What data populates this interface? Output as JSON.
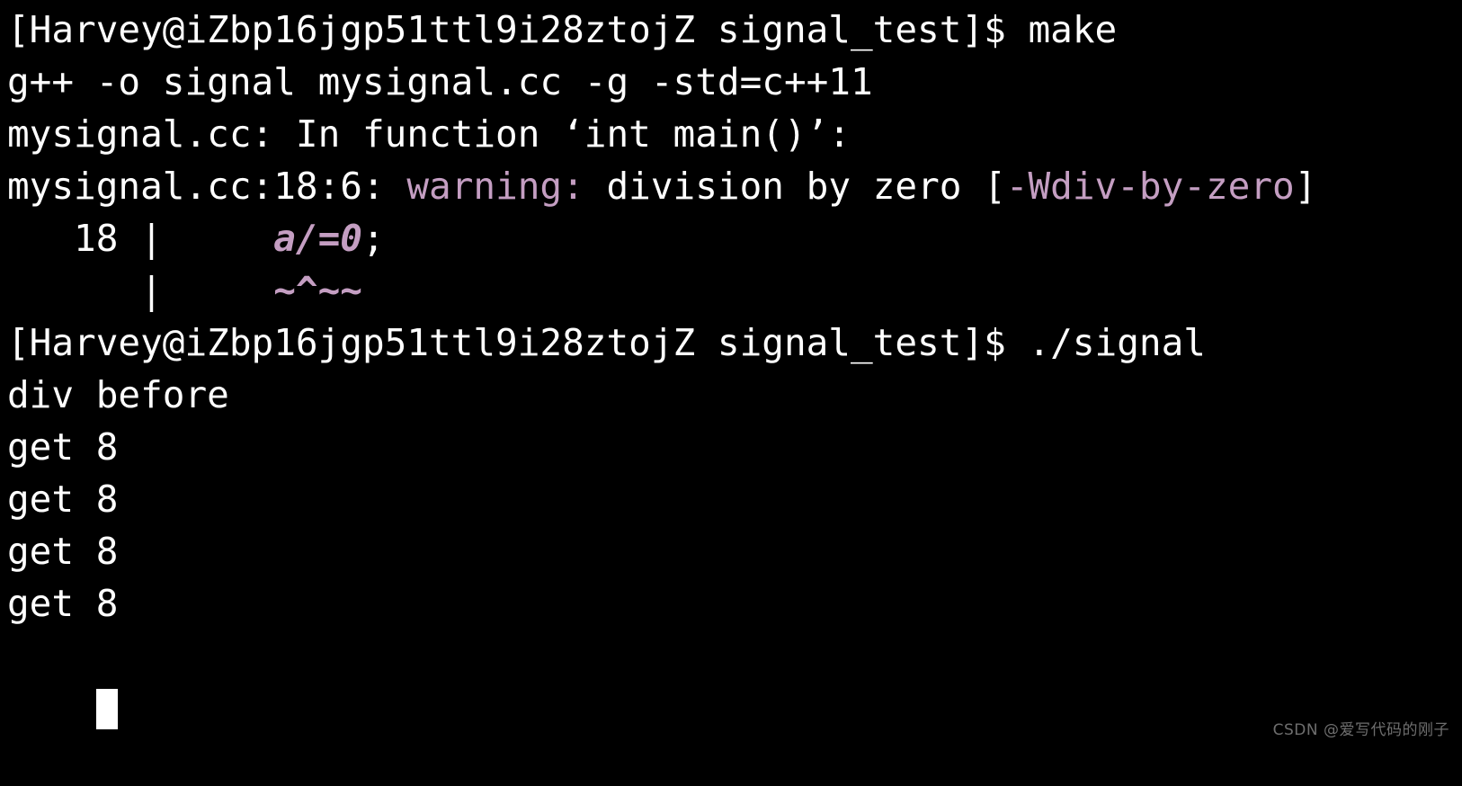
{
  "terminal": {
    "background_color": "#000000",
    "foreground_color": "#ffffff",
    "accent_color": "#c49ec2",
    "prompt": "[Harvey@iZbp16jgp51ttl9i28ztojZ signal_test]$",
    "lines": [
      {
        "id": "line-1-prompt-make",
        "segments": [
          {
            "text": "[Harvey@iZbp16jgp51ttl9i28ztojZ signal_test]$ make",
            "color": "white"
          }
        ]
      },
      {
        "id": "line-2-compile-cmd",
        "segments": [
          {
            "text": "g++ -o signal mysignal.cc -g -std=c++11",
            "color": "white"
          }
        ]
      },
      {
        "id": "line-3-in-function",
        "segments": [
          {
            "text": "mysignal.cc: In function ‘int main()’:",
            "color": "white"
          }
        ]
      },
      {
        "id": "line-4-warning",
        "segments": [
          {
            "text": "mysignal.cc:18:6: ",
            "color": "white"
          },
          {
            "text": "warning:",
            "color": "purple"
          },
          {
            "text": " division by zero [",
            "color": "white"
          },
          {
            "text": "-Wdiv-by-zero",
            "color": "purple"
          },
          {
            "text": "]",
            "color": "white"
          }
        ]
      },
      {
        "id": "line-5-source-18",
        "segments": [
          {
            "text": "   18 |     ",
            "color": "white"
          },
          {
            "text": "a/=0",
            "color": "codehl"
          },
          {
            "text": ";",
            "color": "white"
          }
        ]
      },
      {
        "id": "line-6-squiggle",
        "segments": [
          {
            "text": "      |     ",
            "color": "white"
          },
          {
            "text": "~^~~",
            "color": "squiggle"
          }
        ]
      },
      {
        "id": "line-7-prompt-run",
        "segments": [
          {
            "text": "[Harvey@iZbp16jgp51ttl9i28ztojZ signal_test]$ ./signal",
            "color": "white"
          }
        ]
      },
      {
        "id": "line-8-div-before",
        "segments": [
          {
            "text": "div before",
            "color": "white"
          }
        ]
      },
      {
        "id": "line-9-get-8-a",
        "segments": [
          {
            "text": "get 8",
            "color": "white"
          }
        ]
      },
      {
        "id": "line-10-get-8-b",
        "segments": [
          {
            "text": "get 8",
            "color": "white"
          }
        ]
      },
      {
        "id": "line-11-get-8-c",
        "segments": [
          {
            "text": "get 8",
            "color": "white"
          }
        ]
      },
      {
        "id": "line-12-get-8-d",
        "segments": [
          {
            "text": "get 8",
            "color": "white"
          }
        ]
      }
    ],
    "cursor": {
      "visible": true,
      "shape": "block",
      "color": "#ffffff"
    }
  },
  "watermark": {
    "text": "CSDN @爱写代码的刚子",
    "color": "#6e6e6e"
  }
}
